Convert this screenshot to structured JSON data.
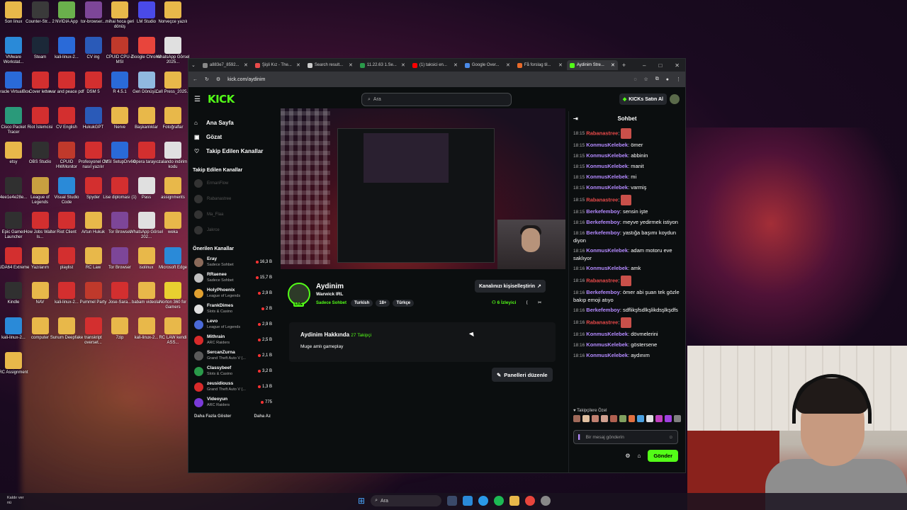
{
  "desktop": {
    "icons": [
      {
        "label": "Son linux",
        "color": "#e8b84a"
      },
      {
        "label": "Counter-Str... 2",
        "color": "#3a3a3a"
      },
      {
        "label": "NVIDIA App",
        "color": "#6ab04c"
      },
      {
        "label": "tor-browser...",
        "color": "#7d4698"
      },
      {
        "label": "mihai hoca geri dönüş",
        "color": "#e8b84a"
      },
      {
        "label": "LM Studio",
        "color": "#4a4ae8"
      },
      {
        "label": "Norveçce yazılı",
        "color": "#e8b84a"
      },
      {
        "label": "VMware Workstat...",
        "color": "#2a8ad8"
      },
      {
        "label": "Steam",
        "color": "#1b2838"
      },
      {
        "label": "kali-linux-2...",
        "color": "#2a6ad8"
      },
      {
        "label": "CV ing",
        "color": "#2a5ab8"
      },
      {
        "label": "CPUID CPU-Z MSI",
        "color": "#c0392b"
      },
      {
        "label": "Google Chrome",
        "color": "#e8453c"
      },
      {
        "label": "WhatsApp Görsel 2025...",
        "color": "#e0e0e0"
      },
      {
        "label": "Oracle VirtualBox",
        "color": "#2a6ad8"
      },
      {
        "label": "Cover letter",
        "color": "#d32f2f"
      },
      {
        "label": "war and peace pdf",
        "color": "#d32f2f"
      },
      {
        "label": "DSM 5",
        "color": "#d32f2f"
      },
      {
        "label": "R 4.5.1",
        "color": "#2a6ad8"
      },
      {
        "label": "Geri Dönüşü...",
        "color": "#90b8e0"
      },
      {
        "label": "Cell Press_2025...",
        "color": "#e8b84a"
      },
      {
        "label": "Cisco Packet Tracer",
        "color": "#2a9a7a"
      },
      {
        "label": "Riot İstemcisi",
        "color": "#d32f2f"
      },
      {
        "label": "CV English",
        "color": "#d32f2f"
      },
      {
        "label": "HukukGPT",
        "color": "#2a5ab8"
      },
      {
        "label": "Nerve",
        "color": "#e8b84a"
      },
      {
        "label": "Başkanlıklar",
        "color": "#e8b84a"
      },
      {
        "label": "Fotoğraflar",
        "color": "#e8b84a"
      },
      {
        "label": "etsy",
        "color": "#e8b84a"
      },
      {
        "label": "OBS Studio",
        "color": "#303030"
      },
      {
        "label": "CPUID HWMonitor",
        "color": "#c0392b"
      },
      {
        "label": "Profesyonel CV nasıl yazılır",
        "color": "#d32f2f"
      },
      {
        "label": "MSI SetupDrv64",
        "color": "#2a6ad8"
      },
      {
        "label": "Opera tarayıcı",
        "color": "#d32f2f"
      },
      {
        "label": "zalando indirim kodu",
        "color": "#e0e0e0"
      },
      {
        "label": "4ee1e4e28e...",
        "color": "#303030"
      },
      {
        "label": "League of Legends",
        "color": "#c8a040"
      },
      {
        "label": "Visual Studio Code",
        "color": "#2a8ad8"
      },
      {
        "label": "Spyder",
        "color": "#d32f2f"
      },
      {
        "label": "Lise diploması (1)",
        "color": "#d32f2f"
      },
      {
        "label": "Pass",
        "color": "#e0e0e0"
      },
      {
        "label": "assignments",
        "color": "#e8b84a"
      },
      {
        "label": "Epic Games Launcher",
        "color": "#303030"
      },
      {
        "label": "How Jobs Walter Is...",
        "color": "#d32f2f"
      },
      {
        "label": "Riot Client",
        "color": "#d32f2f"
      },
      {
        "label": "Artun Hukuk",
        "color": "#e8b84a"
      },
      {
        "label": "Tor Browser",
        "color": "#7d4698"
      },
      {
        "label": "WhatsApp Görsel 202...",
        "color": "#e0e0e0"
      },
      {
        "label": "weka",
        "color": "#e8b84a"
      },
      {
        "label": "AIDA64 Extreme",
        "color": "#d32f2f"
      },
      {
        "label": "Yazılarım",
        "color": "#e8b84a"
      },
      {
        "label": "playlist",
        "color": "#d32f2f"
      },
      {
        "label": "RC Law",
        "color": "#e8b84a"
      },
      {
        "label": "Tor Browser",
        "color": "#7d4698"
      },
      {
        "label": "isolinux",
        "color": "#e8b84a"
      },
      {
        "label": "Microsoft Edge",
        "color": "#2a8ad8"
      },
      {
        "label": "Kindle",
        "color": "#303030"
      },
      {
        "label": "NAV",
        "color": "#e8b84a"
      },
      {
        "label": "kali-linux-2...",
        "color": "#d32f2f"
      },
      {
        "label": "Pummel Party",
        "color": "#c0392b"
      },
      {
        "label": "Jose-Sara...",
        "color": "#d32f2f"
      },
      {
        "label": "babam videolar",
        "color": "#e8b84a"
      },
      {
        "label": "Norton 360 for Gamers",
        "color": "#e8d030"
      },
      {
        "label": "kali-linux-2...",
        "color": "#2a8ad8"
      },
      {
        "label": "computer",
        "color": "#e8b84a"
      },
      {
        "label": "Sunum Deepfake",
        "color": "#e8b84a"
      },
      {
        "label": "transkript overset...",
        "color": "#d32f2f"
      },
      {
        "label": "7zip",
        "color": "#e8b84a"
      },
      {
        "label": "kali-linux-2...",
        "color": "#e8b84a"
      },
      {
        "label": "RC LAW kendi ASS...",
        "color": "#e8b84a"
      },
      {
        "label": "RC Assignment",
        "color": "#e8b84a"
      }
    ]
  },
  "browser": {
    "tabs": [
      {
        "label": "a883e7_8592...",
        "color": "#888888"
      },
      {
        "label": "Şişli Kız - The...",
        "color": "#e84a4a"
      },
      {
        "label": "Search result...",
        "color": "#cccccc"
      },
      {
        "label": "11.22.63 1.Se...",
        "color": "#2a9a4a"
      },
      {
        "label": "(1) taksici en...",
        "color": "#ff0000"
      },
      {
        "label": "Google Over...",
        "color": "#4a8ae8"
      },
      {
        "label": "Få forslag til...",
        "color": "#e86a2a"
      },
      {
        "label": "Aydinim Stre...",
        "color": "#53fc18"
      }
    ],
    "url": "kick.com/aydinim"
  },
  "kick": {
    "logo": "KICK",
    "search_placeholder": "Ara",
    "kicks_button": "KICKs Satın Al",
    "nav": {
      "home": "Ana Sayfa",
      "browse": "Gözat",
      "following": "Takip Edilen Kanallar"
    },
    "followed_header": "Takip Edilen Kanallar",
    "followed": [
      "ErmanFlow",
      "Rabanastree",
      "Ma_Flaa",
      "Jakrce"
    ],
    "recommended_header": "Önerilen Kanallar",
    "recommended": [
      {
        "name": "Eray",
        "category": "Sadece Sohbet",
        "viewers": "16,3 B",
        "color": "#8a6a5a"
      },
      {
        "name": "RRaenee",
        "category": "Sadece Sohbet",
        "viewers": "15,7 B",
        "color": "#c0c0c0"
      },
      {
        "name": "HolyPhoenix",
        "category": "League of Legends",
        "viewers": "2,9 B",
        "color": "#e0a030"
      },
      {
        "name": "FrankDimes",
        "category": "Slots & Casino",
        "viewers": "2 B",
        "color": "#e0e0e0"
      },
      {
        "name": "Levo",
        "category": "League of Legends",
        "viewers": "2,9 B",
        "color": "#4a6ad8"
      },
      {
        "name": "Mithrain",
        "category": "ARC Raiders",
        "viewers": "2,5 B",
        "color": "#d82a2a"
      },
      {
        "name": "SercanZurna",
        "category": "Grand Theft Auto V (...",
        "viewers": "2,1 B",
        "color": "#5a5a5a"
      },
      {
        "name": "Classybeef",
        "category": "Slots & Casino",
        "viewers": "3,2 B",
        "color": "#2a9a4a"
      },
      {
        "name": "zeusidiouss",
        "category": "Grand Theft Auto V (...",
        "viewers": "1,3 B",
        "color": "#d82a2a"
      },
      {
        "name": "Videoyun",
        "category": "ARC Raiders",
        "viewers": "775",
        "color": "#7a3ad8"
      }
    ],
    "show_more": "Daha Fazla Göster",
    "show_less": "Daha Az",
    "channel": {
      "name": "Aydinim",
      "title": "Warwick IRL",
      "category": "Sadece Sohbet",
      "tags": [
        "Turkish",
        "18+",
        "Türkçe"
      ],
      "live": "LIVE",
      "viewers": "6 İzleyici",
      "customize_button": "Kanalınızı kişiselleştirin"
    },
    "about": {
      "heading": "Aydinim Hakkında",
      "followers": "27 Takipçi",
      "description": "Muge amlı gameplay"
    },
    "panels_button": "Panelleri düzenle",
    "chat": {
      "title": "Sohbet",
      "messages": [
        {
          "time": "18:15",
          "user": "Rabanastree",
          "text": "",
          "color": "#e84a4a",
          "emote": true
        },
        {
          "time": "18:15",
          "user": "KonmusKelebek",
          "text": "ömer",
          "color": "#b48aff",
          "emote": false
        },
        {
          "time": "18:15",
          "user": "KonmusKelebek",
          "text": "abbinin",
          "color": "#b48aff",
          "emote": false
        },
        {
          "time": "18:15",
          "user": "KonmusKelebek",
          "text": "manit",
          "color": "#b48aff",
          "emote": false
        },
        {
          "time": "18:15",
          "user": "KonmusKelebek",
          "text": "mi",
          "color": "#b48aff",
          "emote": false
        },
        {
          "time": "18:15",
          "user": "KonmusKelebek",
          "text": "varmiş",
          "color": "#b48aff",
          "emote": false
        },
        {
          "time": "18:15",
          "user": "Rabanastree",
          "text": "",
          "color": "#e84a4a",
          "emote": true
        },
        {
          "time": "18:15",
          "user": "Berkefemboy",
          "text": "sensin işte",
          "color": "#b48aff",
          "emote": false
        },
        {
          "time": "18:16",
          "user": "Berkefemboy",
          "text": "meyve yedirmek istiyon",
          "color": "#b48aff",
          "emote": false
        },
        {
          "time": "18:16",
          "user": "Berkefemboy",
          "text": "yastığa başımı koydun diyon",
          "color": "#b48aff",
          "emote": false
        },
        {
          "time": "18:16",
          "user": "KonmusKelebek",
          "text": "adam motoru eve saklıyor",
          "color": "#b48aff",
          "emote": false
        },
        {
          "time": "18:16",
          "user": "KonmusKelebek",
          "text": "amk",
          "color": "#b48aff",
          "emote": false
        },
        {
          "time": "18:16",
          "user": "Rabanastree",
          "text": "",
          "color": "#e84a4a",
          "emote": true
        },
        {
          "time": "18:16",
          "user": "Berkefemboy",
          "text": "ömer abi şuan tek gözle bakıp emoji atıyo",
          "color": "#b48aff",
          "emote": false
        },
        {
          "time": "18:16",
          "user": "Berkefemboy",
          "text": "sdflikşfsdlkşlikdsşlkşdfs",
          "color": "#b48aff",
          "emote": false
        },
        {
          "time": "18:16",
          "user": "Rabanastree",
          "text": "",
          "color": "#e84a4a",
          "emote": true
        },
        {
          "time": "18:16",
          "user": "KonmusKelebek",
          "text": "dövmelerini",
          "color": "#b48aff",
          "emote": false
        },
        {
          "time": "18:16",
          "user": "KonmusKelebek",
          "text": "göstersene",
          "color": "#b48aff",
          "emote": false
        },
        {
          "time": "18:16",
          "user": "KonmusKelebek",
          "text": "aydınım",
          "color": "#b48aff",
          "emote": false
        }
      ],
      "emote_label": "Takipçilere Özel",
      "input_placeholder": "Bir mesaj gönderin",
      "send_button": "Gönder"
    }
  },
  "taskbar": {
    "left_text_1": "Kaldır ver",
    "left_text_2": "nü",
    "search": "Ara"
  },
  "colors": {
    "accent": "#53fc18",
    "background": "#0b0e0f"
  }
}
